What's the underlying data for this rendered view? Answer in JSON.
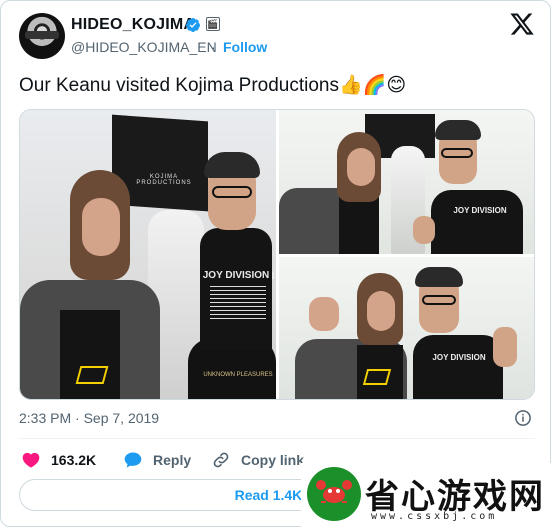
{
  "header": {
    "display_name": "HIDEO_KOJIMA",
    "affiliate_badge_glyph": "🎬",
    "handle": "@HIDEO_KOJIMA_EN",
    "separator": "·",
    "follow_label": "Follow"
  },
  "tweet": {
    "text": "Our Keanu visited Kojima Productions",
    "emojis": [
      "👍",
      "🌈",
      "😊"
    ]
  },
  "media": {
    "photos": [
      {
        "name": "photo-1",
        "shirt_text": "JOY DIVISION",
        "shirt_sub": "UNKNOWN PLEASURES",
        "flag_text": "KOJIMA PRODUCTIONS"
      },
      {
        "name": "photo-2",
        "shirt_text": "JOY DIVISION"
      },
      {
        "name": "photo-3",
        "shirt_text": "JOY DIVISION"
      }
    ]
  },
  "meta": {
    "timestamp": "2:33 PM · Sep 7, 2019"
  },
  "actions": {
    "like_count": "163.2K",
    "reply_label": "Reply",
    "copy_link_label": "Copy link"
  },
  "read_replies_label": "Read 1.4K re",
  "watermark": {
    "title": "省心游戏网",
    "url": "www.cssxbj.com"
  },
  "colors": {
    "accent": "#1d9bf0",
    "like": "#f91880",
    "text_primary": "#0f1419",
    "text_secondary": "#536471",
    "watermark_green": "#1a8f2a"
  },
  "icons": {
    "verified": "verified-badge-icon",
    "x_logo": "x-logo-icon",
    "info": "info-icon",
    "like": "heart-icon",
    "reply": "speech-bubble-icon",
    "copy": "link-icon"
  }
}
